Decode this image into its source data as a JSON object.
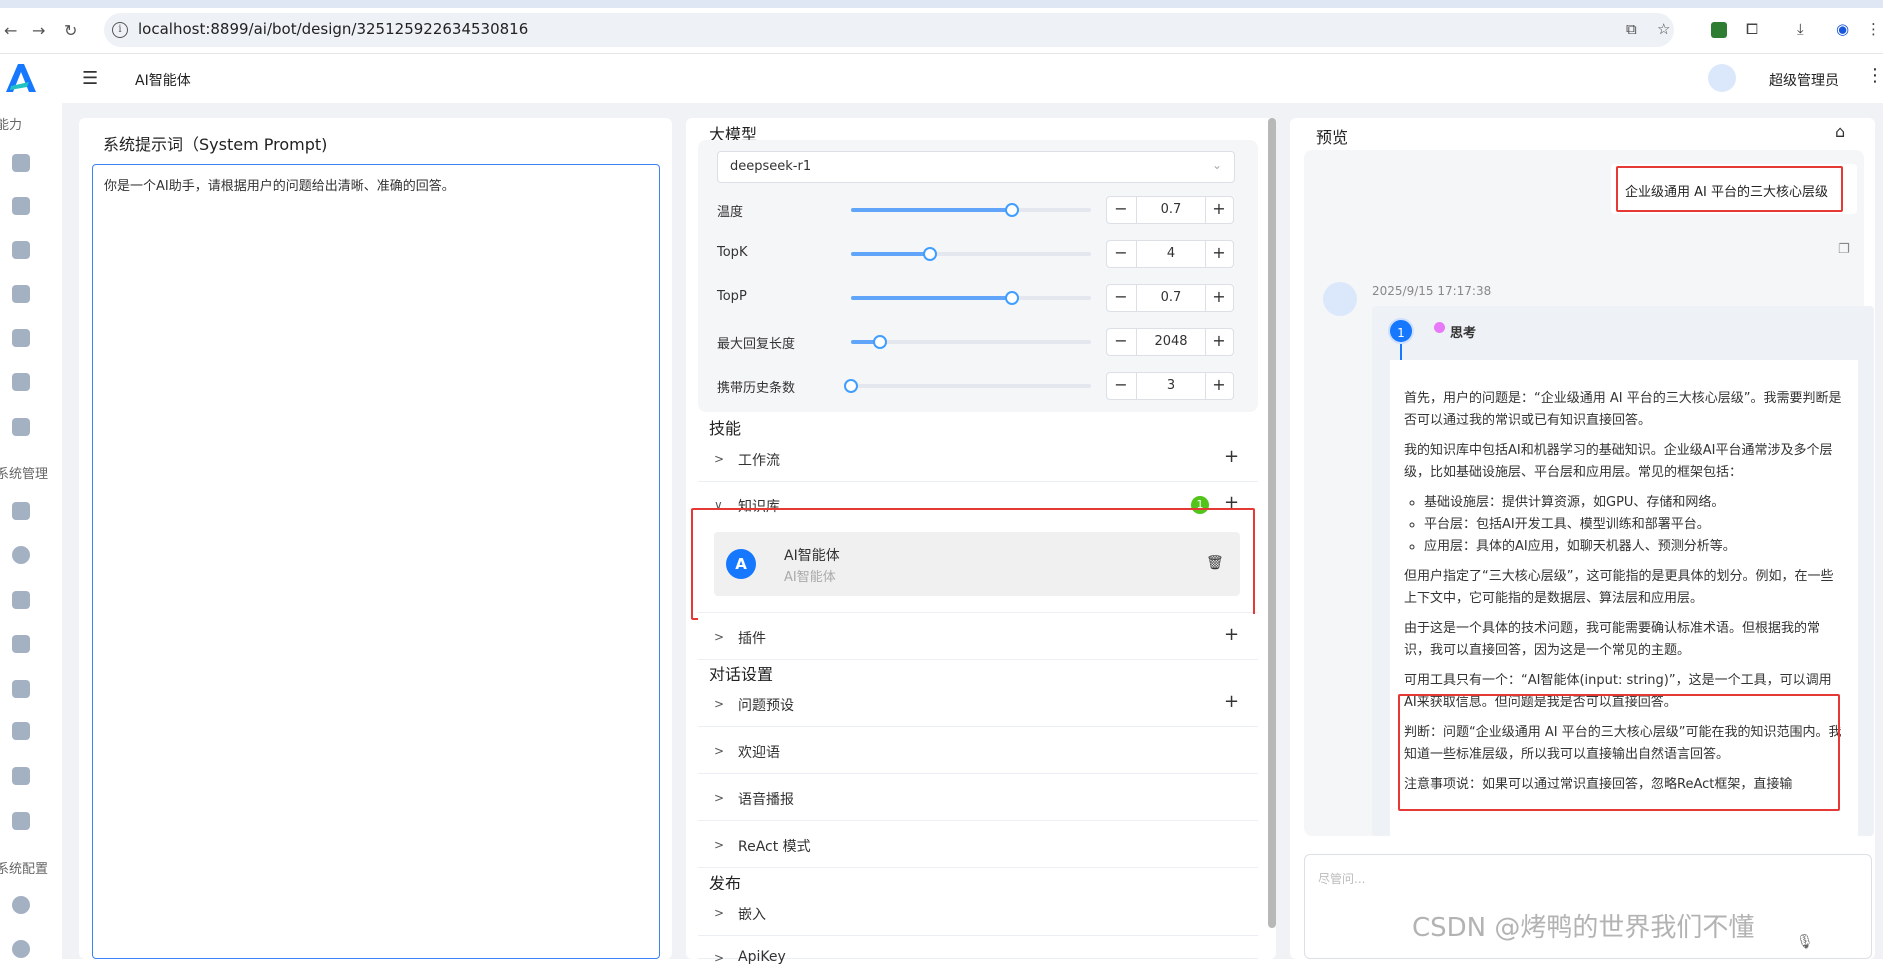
{
  "browser": {
    "url": "localhost:8899/ai/bot/design/325125922634530816"
  },
  "app": {
    "title": "AI智能体",
    "user": "超级管理员"
  },
  "sidebar": {
    "categories": [
      "能力",
      "系统管理",
      "系统配置"
    ]
  },
  "prompt": {
    "title": "系统提示词（System Prompt)",
    "value": "你是一个AI助手，请根据用户的问题给出清晰、准确的回答。"
  },
  "model": {
    "section_title": "大模型",
    "selected": "deepseek-r1",
    "params": [
      {
        "label": "温度",
        "value": "0.7",
        "fraction": 0.67
      },
      {
        "label": "TopK",
        "value": "4",
        "fraction": 0.33
      },
      {
        "label": "TopP",
        "value": "0.7",
        "fraction": 0.67
      },
      {
        "label": "最大回复长度",
        "value": "2048",
        "fraction": 0.12
      },
      {
        "label": "携带历史条数",
        "value": "3",
        "fraction": 0.0
      }
    ]
  },
  "skills": {
    "section_title": "技能",
    "workflow": "工作流",
    "knowledge": "知识库",
    "knowledge_count": "1",
    "kb_item": {
      "name": "AI智能体",
      "desc": "AI智能体"
    },
    "plugin": "插件"
  },
  "dialog": {
    "section_title": "对话设置",
    "items": [
      "问题预设",
      "欢迎语",
      "语音播报",
      "ReAct 模式"
    ]
  },
  "publish": {
    "section_title": "发布",
    "items": [
      "嵌入",
      "ApiKey"
    ]
  },
  "preview": {
    "title": "预览",
    "user_message": "企业级通用 AI 平台的三大核心层级",
    "bot_time": "2025/9/15 17:17:38",
    "step": "1",
    "think_label": "思考",
    "para1": "首先，用户的问题是：“企业级通用 AI 平台的三大核心层级”。我需要判断是否可以通过我的常识或已有知识直接回答。",
    "para2": "我的知识库中包括AI和机器学习的基础知识。企业级AI平台通常涉及多个层级，比如基础设施层、平台层和应用层。常见的框架包括：",
    "bullets": [
      "基础设施层：提供计算资源，如GPU、存储和网络。",
      "平台层：包括AI开发工具、模型训练和部署平台。",
      "应用层：具体的AI应用，如聊天机器人、预测分析等。"
    ],
    "para3": "但用户指定了“三大核心层级”，这可能指的是更具体的划分。例如，在一些上下文中，它可能指的是数据层、算法层和应用层。",
    "para4": "由于这是一个具体的技术问题，我可能需要确认标准术语。但根据我的常识，我可以直接回答，因为这是一个常见的主题。",
    "para5": "可用工具只有一个：“AI智能体(input: string)”，这是一个工具，可以调用AI来获取信息。但问题是我是否可以直接回答。",
    "para6": "判断：问题“企业级通用 AI 平台的三大核心层级”可能在我的知识范围内。我知道一些标准层级，所以我可以直接输出自然语言回答。",
    "para7": "注意事项说：如果可以通过常识直接回答，忽略ReAct框架，直接输",
    "input_placeholder": "尽管问..."
  },
  "watermark": "CSDN @烤鸭的世界我们不懂"
}
